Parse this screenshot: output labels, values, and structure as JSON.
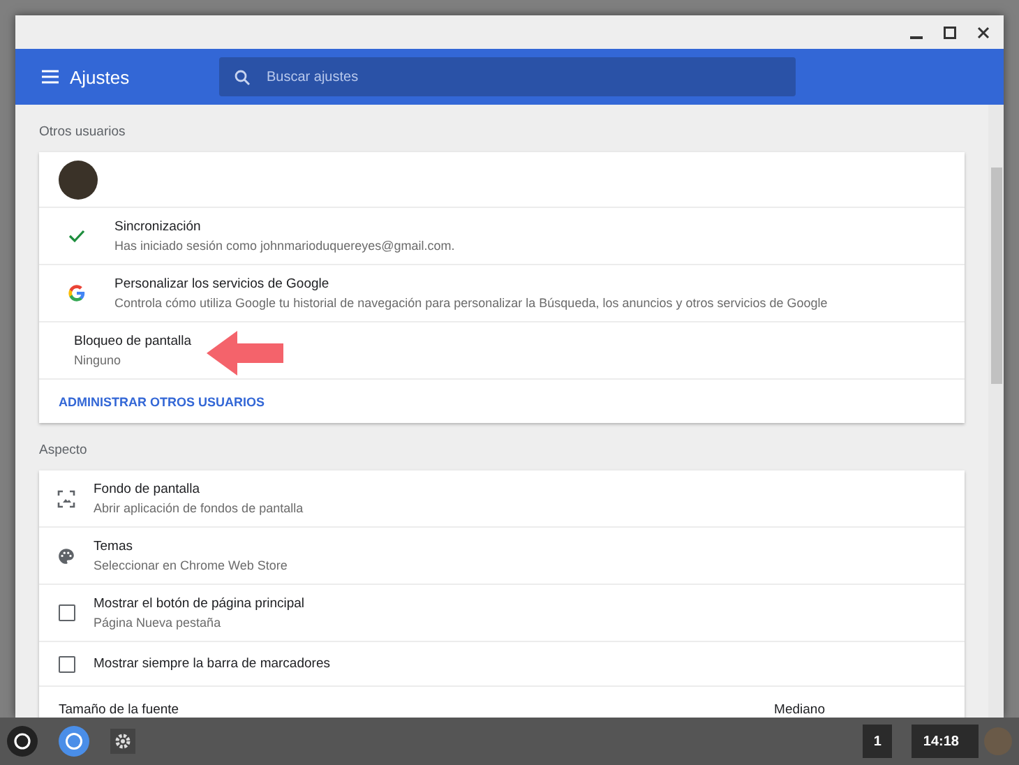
{
  "header": {
    "title": "Ajustes",
    "search": {
      "placeholder": "Buscar ajustes"
    }
  },
  "sections": [
    {
      "title": "Otros usuarios",
      "rows": [
        {
          "kind": "avatar"
        },
        {
          "kind": "sync",
          "title": "Sincronización",
          "subtitle": "Has iniciado sesión como johnmarioduquereyes@gmail.com."
        },
        {
          "kind": "google",
          "title": "Personalizar los servicios de Google",
          "subtitle": "Controla cómo utiliza Google tu historial de navegación para personalizar la Búsqueda, los anuncios y otros servicios de Google"
        },
        {
          "kind": "plain",
          "title": "Bloqueo de pantalla",
          "subtitle": "Ninguno",
          "annotated": true
        },
        {
          "kind": "link",
          "title": "ADMINISTRAR OTROS USUARIOS"
        }
      ]
    },
    {
      "title": "Aspecto",
      "rows": [
        {
          "kind": "wallpaper",
          "title": "Fondo de pantalla",
          "subtitle": "Abrir aplicación de fondos de pantalla"
        },
        {
          "kind": "palette",
          "title": "Temas",
          "subtitle": "Seleccionar en Chrome Web Store"
        },
        {
          "kind": "checkbox",
          "title": "Mostrar el botón de página principal",
          "subtitle": "Página Nueva pestaña",
          "checked": false
        },
        {
          "kind": "checkbox",
          "title": "Mostrar siempre la barra de marcadores",
          "checked": false
        },
        {
          "kind": "dropdown",
          "title": "Tamaño de la fuente",
          "value": "Mediano"
        }
      ]
    }
  ],
  "taskbar": {
    "workspace": "1",
    "clock": "14:18"
  }
}
